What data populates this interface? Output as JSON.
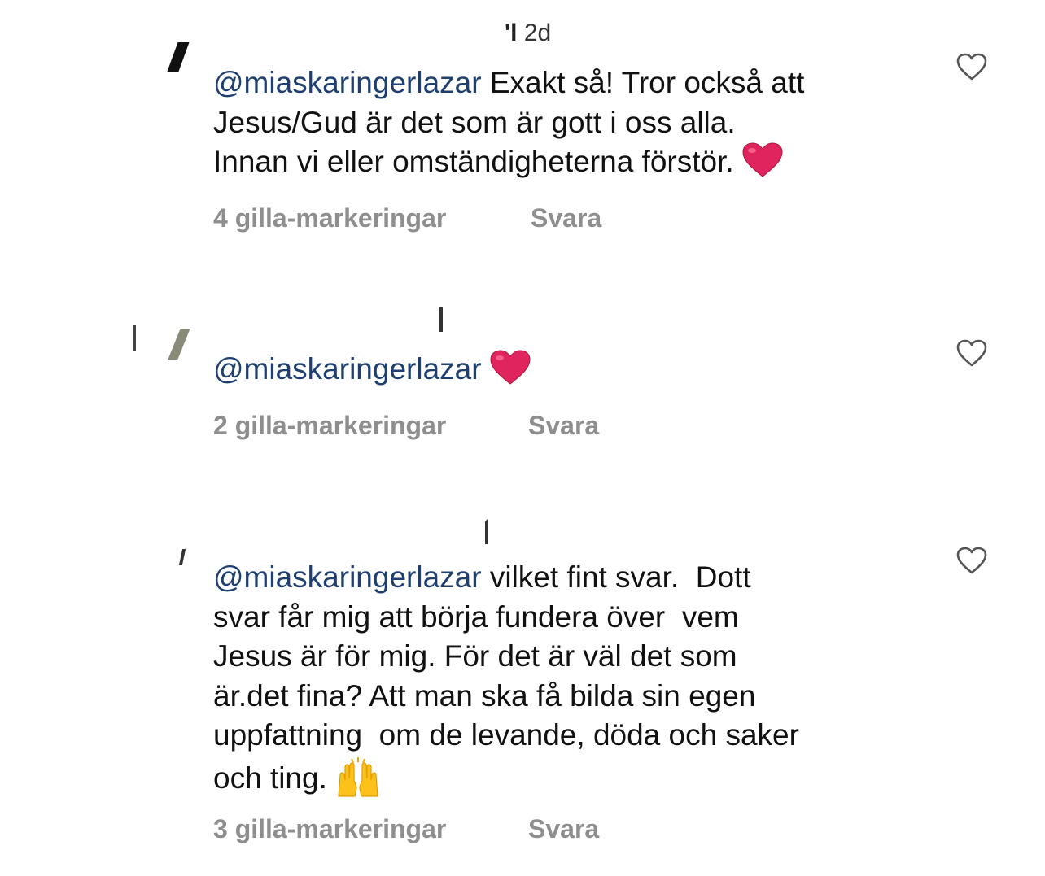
{
  "comments": [
    {
      "time": "2d",
      "mention": "@miaskaringerlazar",
      "text_lines": [
        " Exakt så! Tror också att",
        "Jesus/Gud är det som är gott i oss alla.",
        "Innan vi eller omständigheterna förstör. "
      ],
      "likes": "4 gilla-markeringar",
      "reply": "Svara"
    },
    {
      "mention": "@miaskaringerlazar",
      "text_lines": [
        " "
      ],
      "likes": "2 gilla-markeringar",
      "reply": "Svara"
    },
    {
      "mention": "@miaskaringerlazar",
      "text_lines": [
        " vilket fint svar.  Dott",
        "svar får mig att börja fundera över  vem",
        "Jesus är för mig. För det är väl det som",
        "är.det fina? Att man ska få bilda sin egen",
        "uppfattning  om de levande, döda och saker",
        "och ting. "
      ],
      "likes": "3 gilla-markeringar",
      "reply": "Svara"
    }
  ],
  "icons": {
    "like": "heart-outline-icon",
    "heart_emoji": "red-heart-emoji",
    "clap_emoji": "raised-hands-emoji"
  },
  "colors": {
    "mention": "#1e3f6f",
    "meta": "#8e8e8e",
    "heart": "#e0245e"
  }
}
